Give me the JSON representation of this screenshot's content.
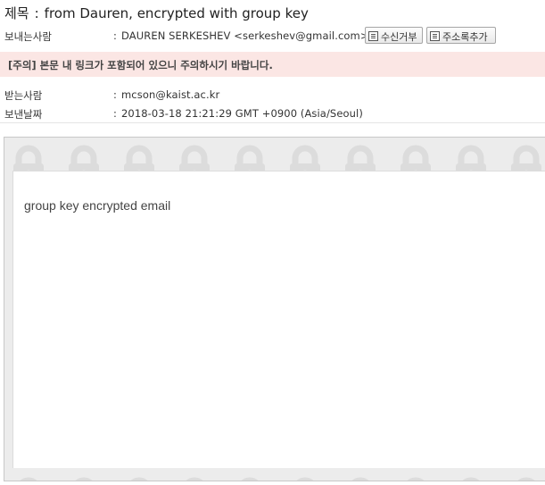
{
  "subject": {
    "label": "제목",
    "separator": ":",
    "text": "from Dauren, encrypted with group key"
  },
  "sender": {
    "label": "보내는사람",
    "colon": ":",
    "value": "DAUREN SERKESHEV <serkeshev@gmail.com>",
    "reject_button_label": "수신거부",
    "add_address_button_label": "주소록추가"
  },
  "warning_text": "[주의] 본문 내 링크가 포함되어 있으니 주의하시기 바랍니다.",
  "recipient": {
    "label": "받는사람",
    "colon": ":",
    "value": "mcson@kaist.ac.kr"
  },
  "sent_date": {
    "label": "보낸날짜",
    "colon": ":",
    "value": "2018-03-18 21:21:29 GMT +0900 (Asia/Seoul)"
  },
  "message_body": "group key encrypted email",
  "colors": {
    "warning_background": "#fbe6e4",
    "frame_background": "#ececec"
  }
}
